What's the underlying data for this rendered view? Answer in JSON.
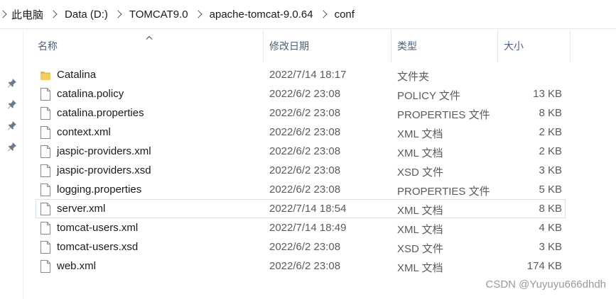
{
  "breadcrumb": [
    "此电脑",
    "Data (D:)",
    "TOMCAT9.0",
    "apache-tomcat-9.0.64",
    "conf"
  ],
  "columns": {
    "name": "名称",
    "date": "修改日期",
    "type": "类型",
    "size": "大小"
  },
  "files": [
    {
      "name": "Catalina",
      "date": "2022/7/14 18:17",
      "type": "文件夹",
      "size": "",
      "icon": "folder-icon"
    },
    {
      "name": "catalina.policy",
      "date": "2022/6/2 23:08",
      "type": "POLICY 文件",
      "size": "13 KB",
      "icon": "file-icon"
    },
    {
      "name": "catalina.properties",
      "date": "2022/6/2 23:08",
      "type": "PROPERTIES 文件",
      "size": "8 KB",
      "icon": "file-icon"
    },
    {
      "name": "context.xml",
      "date": "2022/6/2 23:08",
      "type": "XML 文档",
      "size": "2 KB",
      "icon": "file-icon"
    },
    {
      "name": "jaspic-providers.xml",
      "date": "2022/6/2 23:08",
      "type": "XML 文档",
      "size": "2 KB",
      "icon": "file-icon"
    },
    {
      "name": "jaspic-providers.xsd",
      "date": "2022/6/2 23:08",
      "type": "XSD 文件",
      "size": "3 KB",
      "icon": "file-icon"
    },
    {
      "name": "logging.properties",
      "date": "2022/6/2 23:08",
      "type": "PROPERTIES 文件",
      "size": "5 KB",
      "icon": "file-icon"
    },
    {
      "name": "server.xml",
      "date": "2022/7/14 18:54",
      "type": "XML 文档",
      "size": "8 KB",
      "icon": "file-icon",
      "selected": true
    },
    {
      "name": "tomcat-users.xml",
      "date": "2022/7/14 18:49",
      "type": "XML 文档",
      "size": "4 KB",
      "icon": "file-icon"
    },
    {
      "name": "tomcat-users.xsd",
      "date": "2022/6/2 23:08",
      "type": "XSD 文件",
      "size": "3 KB",
      "icon": "file-icon"
    },
    {
      "name": "web.xml",
      "date": "2022/6/2 23:08",
      "type": "XML 文档",
      "size": "174 KB",
      "icon": "file-icon"
    }
  ],
  "watermark": "CSDN @Yuyuyu666dhdh",
  "colors": {
    "header_text": "#4c607a",
    "selection_border": "#cde3f7",
    "folder": "#e8b94a",
    "meta_text": "#5b5b5b"
  }
}
